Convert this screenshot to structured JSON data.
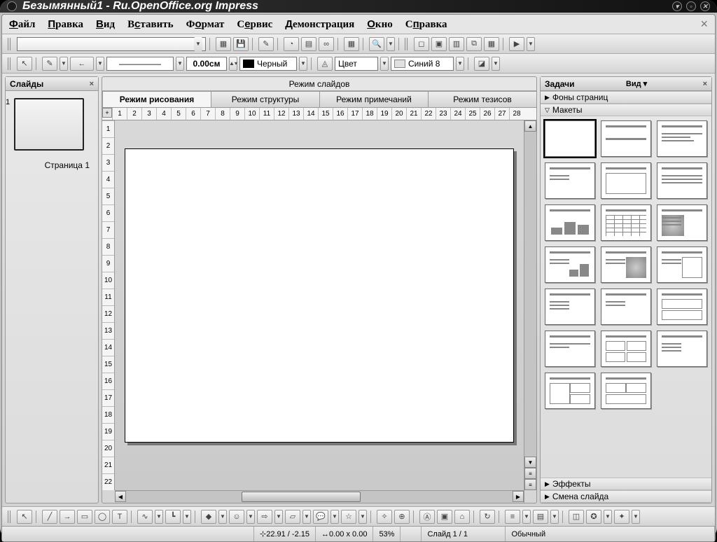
{
  "title": "Безымянный1 - Ru.OpenOffice.org Impress",
  "menus": [
    "Файл",
    "Правка",
    "Вид",
    "Вставить",
    "Формат",
    "Сервис",
    "Демонстрация",
    "Окно",
    "Справка"
  ],
  "line_size": "0.00см",
  "line_color_label": "Черный",
  "fill_type_label": "Цвет",
  "fill_color_label": "Синий 8",
  "slides_panel_title": "Слайды",
  "slide_thumb_label": "Страница 1",
  "slide_thumb_num": "1",
  "mode_title": "Режим слайдов",
  "tabs": [
    "Режим рисования",
    "Режим структуры",
    "Режим примечаний",
    "Режим тезисов"
  ],
  "ruler_h": [
    "1",
    "2",
    "3",
    "4",
    "5",
    "6",
    "7",
    "8",
    "9",
    "10",
    "11",
    "12",
    "13",
    "14",
    "15",
    "16",
    "17",
    "18",
    "19",
    "20",
    "21",
    "22",
    "23",
    "24",
    "25",
    "26",
    "27",
    "28"
  ],
  "ruler_v": [
    "1",
    "2",
    "3",
    "4",
    "5",
    "6",
    "7",
    "8",
    "9",
    "10",
    "11",
    "12",
    "13",
    "14",
    "15",
    "16",
    "17",
    "18",
    "19",
    "20",
    "21",
    "22"
  ],
  "tasks_title": "Задачи",
  "tasks_view_label": "Вид",
  "section_backgrounds": "Фоны страниц",
  "section_layouts": "Макеты",
  "section_effects": "Эффекты",
  "section_transition": "Смена слайда",
  "status": {
    "pos": "22.91 / -2.15",
    "size": "0.00 x 0.00",
    "zoom": "53%",
    "slide": "Слайд 1 / 1",
    "mode": "Обычный"
  }
}
